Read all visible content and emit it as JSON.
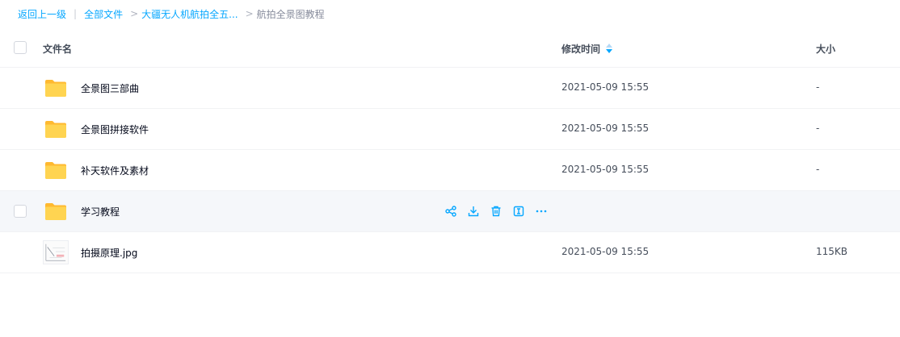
{
  "breadcrumb": {
    "back": "返回上一级",
    "separator_bar": "|",
    "all_files": "全部文件",
    "parent": "大疆无人机航拍全五...",
    "current": "航拍全景图教程",
    "arrow": ">"
  },
  "header": {
    "name": "文件名",
    "time": "修改时间",
    "size": "大小"
  },
  "rows": [
    {
      "type": "folder",
      "name": "全景图三部曲",
      "time": "2021-05-09 15:55",
      "size": "-"
    },
    {
      "type": "folder",
      "name": "全景图拼接软件",
      "time": "2021-05-09 15:55",
      "size": "-"
    },
    {
      "type": "folder",
      "name": "补天软件及素材",
      "time": "2021-05-09 15:55",
      "size": "-"
    },
    {
      "type": "folder",
      "name": "学习教程",
      "time": "",
      "size": ""
    },
    {
      "type": "image",
      "name": "拍摄原理.jpg",
      "time": "2021-05-09 15:55",
      "size": "115KB"
    }
  ],
  "colors": {
    "link": "#06a7ff",
    "folder": "#ffc83d",
    "hover_row": "#f5f7fa"
  },
  "icons": [
    "folder-icon",
    "share-icon",
    "download-icon",
    "delete-icon",
    "rename-icon",
    "more-icon",
    "sort-icon"
  ]
}
